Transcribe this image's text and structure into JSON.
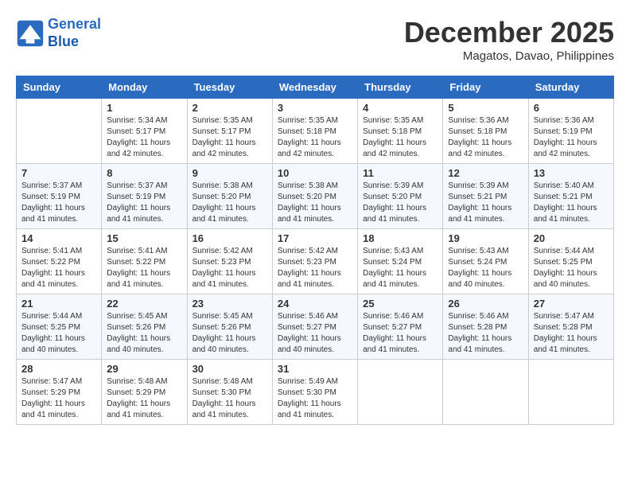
{
  "header": {
    "logo_line1": "General",
    "logo_line2": "Blue",
    "month": "December 2025",
    "location": "Magatos, Davao, Philippines"
  },
  "days_of_week": [
    "Sunday",
    "Monday",
    "Tuesday",
    "Wednesday",
    "Thursday",
    "Friday",
    "Saturday"
  ],
  "weeks": [
    [
      {
        "day": "",
        "info": ""
      },
      {
        "day": "1",
        "info": "Sunrise: 5:34 AM\nSunset: 5:17 PM\nDaylight: 11 hours\nand 42 minutes."
      },
      {
        "day": "2",
        "info": "Sunrise: 5:35 AM\nSunset: 5:17 PM\nDaylight: 11 hours\nand 42 minutes."
      },
      {
        "day": "3",
        "info": "Sunrise: 5:35 AM\nSunset: 5:18 PM\nDaylight: 11 hours\nand 42 minutes."
      },
      {
        "day": "4",
        "info": "Sunrise: 5:35 AM\nSunset: 5:18 PM\nDaylight: 11 hours\nand 42 minutes."
      },
      {
        "day": "5",
        "info": "Sunrise: 5:36 AM\nSunset: 5:18 PM\nDaylight: 11 hours\nand 42 minutes."
      },
      {
        "day": "6",
        "info": "Sunrise: 5:36 AM\nSunset: 5:19 PM\nDaylight: 11 hours\nand 42 minutes."
      }
    ],
    [
      {
        "day": "7",
        "info": "Sunrise: 5:37 AM\nSunset: 5:19 PM\nDaylight: 11 hours\nand 41 minutes."
      },
      {
        "day": "8",
        "info": "Sunrise: 5:37 AM\nSunset: 5:19 PM\nDaylight: 11 hours\nand 41 minutes."
      },
      {
        "day": "9",
        "info": "Sunrise: 5:38 AM\nSunset: 5:20 PM\nDaylight: 11 hours\nand 41 minutes."
      },
      {
        "day": "10",
        "info": "Sunrise: 5:38 AM\nSunset: 5:20 PM\nDaylight: 11 hours\nand 41 minutes."
      },
      {
        "day": "11",
        "info": "Sunrise: 5:39 AM\nSunset: 5:20 PM\nDaylight: 11 hours\nand 41 minutes."
      },
      {
        "day": "12",
        "info": "Sunrise: 5:39 AM\nSunset: 5:21 PM\nDaylight: 11 hours\nand 41 minutes."
      },
      {
        "day": "13",
        "info": "Sunrise: 5:40 AM\nSunset: 5:21 PM\nDaylight: 11 hours\nand 41 minutes."
      }
    ],
    [
      {
        "day": "14",
        "info": "Sunrise: 5:41 AM\nSunset: 5:22 PM\nDaylight: 11 hours\nand 41 minutes."
      },
      {
        "day": "15",
        "info": "Sunrise: 5:41 AM\nSunset: 5:22 PM\nDaylight: 11 hours\nand 41 minutes."
      },
      {
        "day": "16",
        "info": "Sunrise: 5:42 AM\nSunset: 5:23 PM\nDaylight: 11 hours\nand 41 minutes."
      },
      {
        "day": "17",
        "info": "Sunrise: 5:42 AM\nSunset: 5:23 PM\nDaylight: 11 hours\nand 41 minutes."
      },
      {
        "day": "18",
        "info": "Sunrise: 5:43 AM\nSunset: 5:24 PM\nDaylight: 11 hours\nand 41 minutes."
      },
      {
        "day": "19",
        "info": "Sunrise: 5:43 AM\nSunset: 5:24 PM\nDaylight: 11 hours\nand 40 minutes."
      },
      {
        "day": "20",
        "info": "Sunrise: 5:44 AM\nSunset: 5:25 PM\nDaylight: 11 hours\nand 40 minutes."
      }
    ],
    [
      {
        "day": "21",
        "info": "Sunrise: 5:44 AM\nSunset: 5:25 PM\nDaylight: 11 hours\nand 40 minutes."
      },
      {
        "day": "22",
        "info": "Sunrise: 5:45 AM\nSunset: 5:26 PM\nDaylight: 11 hours\nand 40 minutes."
      },
      {
        "day": "23",
        "info": "Sunrise: 5:45 AM\nSunset: 5:26 PM\nDaylight: 11 hours\nand 40 minutes."
      },
      {
        "day": "24",
        "info": "Sunrise: 5:46 AM\nSunset: 5:27 PM\nDaylight: 11 hours\nand 40 minutes."
      },
      {
        "day": "25",
        "info": "Sunrise: 5:46 AM\nSunset: 5:27 PM\nDaylight: 11 hours\nand 41 minutes."
      },
      {
        "day": "26",
        "info": "Sunrise: 5:46 AM\nSunset: 5:28 PM\nDaylight: 11 hours\nand 41 minutes."
      },
      {
        "day": "27",
        "info": "Sunrise: 5:47 AM\nSunset: 5:28 PM\nDaylight: 11 hours\nand 41 minutes."
      }
    ],
    [
      {
        "day": "28",
        "info": "Sunrise: 5:47 AM\nSunset: 5:29 PM\nDaylight: 11 hours\nand 41 minutes."
      },
      {
        "day": "29",
        "info": "Sunrise: 5:48 AM\nSunset: 5:29 PM\nDaylight: 11 hours\nand 41 minutes."
      },
      {
        "day": "30",
        "info": "Sunrise: 5:48 AM\nSunset: 5:30 PM\nDaylight: 11 hours\nand 41 minutes."
      },
      {
        "day": "31",
        "info": "Sunrise: 5:49 AM\nSunset: 5:30 PM\nDaylight: 11 hours\nand 41 minutes."
      },
      {
        "day": "",
        "info": ""
      },
      {
        "day": "",
        "info": ""
      },
      {
        "day": "",
        "info": ""
      }
    ]
  ]
}
